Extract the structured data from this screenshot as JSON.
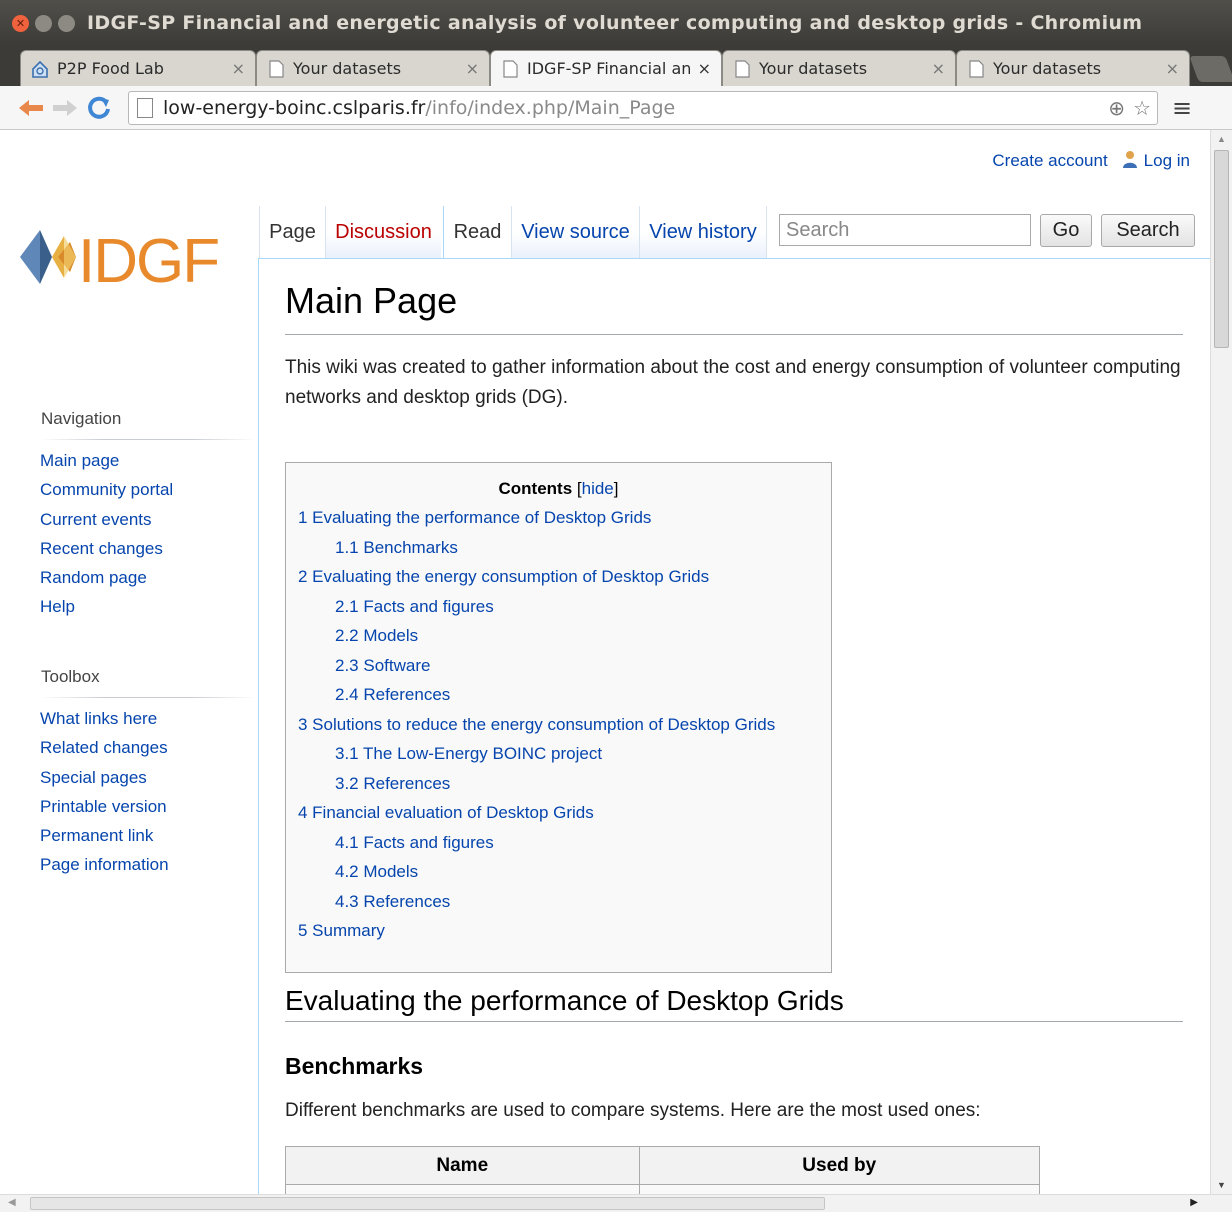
{
  "window": {
    "title": "IDGF-SP Financial and energetic analysis of volunteer computing and desktop grids - Chromium"
  },
  "tabs": [
    {
      "label": "P2P Food Lab",
      "icon": "home-icon",
      "active": false
    },
    {
      "label": "Your datasets",
      "icon": "page-icon",
      "active": false
    },
    {
      "label": "IDGF-SP Financial an",
      "icon": "page-icon",
      "active": true
    },
    {
      "label": "Your datasets",
      "icon": "page-icon",
      "active": false
    },
    {
      "label": "Your datasets",
      "icon": "page-icon",
      "active": false
    }
  ],
  "omnibox": {
    "host": "low-energy-boinc.cslparis.fr",
    "path": "/info/index.php/Main_Page"
  },
  "personal": {
    "create_account": "Create account",
    "log_in": "Log in"
  },
  "logo_text": "IDGF",
  "page_tabs": {
    "page": "Page",
    "discussion": "Discussion",
    "read": "Read",
    "view_source": "View source",
    "view_history": "View history"
  },
  "search": {
    "placeholder": "Search",
    "go_label": "Go",
    "search_label": "Search"
  },
  "sidebar": {
    "navigation_heading": "Navigation",
    "navigation": [
      "Main page",
      "Community portal",
      "Current events",
      "Recent changes",
      "Random page",
      "Help"
    ],
    "toolbox_heading": "Toolbox",
    "toolbox": [
      "What links here",
      "Related changes",
      "Special pages",
      "Printable version",
      "Permanent link",
      "Page information"
    ]
  },
  "content": {
    "title": "Main Page",
    "intro": "This wiki was created to gather information about the cost and energy consumption of volunteer computing networks and desktop grids (DG).",
    "toc_title": "Contents",
    "toc_hide": "hide",
    "toc": [
      {
        "text": "1 Evaluating the performance of Desktop Grids",
        "level": 1
      },
      {
        "text": "1.1 Benchmarks",
        "level": 2
      },
      {
        "text": "2 Evaluating the energy consumption of Desktop Grids",
        "level": 1
      },
      {
        "text": "2.1 Facts and figures",
        "level": 2
      },
      {
        "text": "2.2 Models",
        "level": 2
      },
      {
        "text": "2.3 Software",
        "level": 2
      },
      {
        "text": "2.4 References",
        "level": 2
      },
      {
        "text": "3 Solutions to reduce the energy consumption of Desktop Grids",
        "level": 1
      },
      {
        "text": "3.1 The Low-Energy BOINC project",
        "level": 2
      },
      {
        "text": "3.2 References",
        "level": 2
      },
      {
        "text": "4 Financial evaluation of Desktop Grids",
        "level": 1
      },
      {
        "text": "4.1 Facts and figures",
        "level": 2
      },
      {
        "text": "4.2 Models",
        "level": 2
      },
      {
        "text": "4.3 References",
        "level": 2
      },
      {
        "text": "5 Summary",
        "level": 1
      }
    ],
    "section1_heading": "Evaluating the performance of Desktop Grids",
    "subsection_heading": "Benchmarks",
    "subsection_text": "Different benchmarks are used to compare systems. Here are the most used ones:",
    "table_headers": [
      "Name",
      "Used by"
    ]
  },
  "colors": {
    "link": "#0645ad",
    "new_link": "#ba0000",
    "title_bar": "#3c3b37"
  }
}
